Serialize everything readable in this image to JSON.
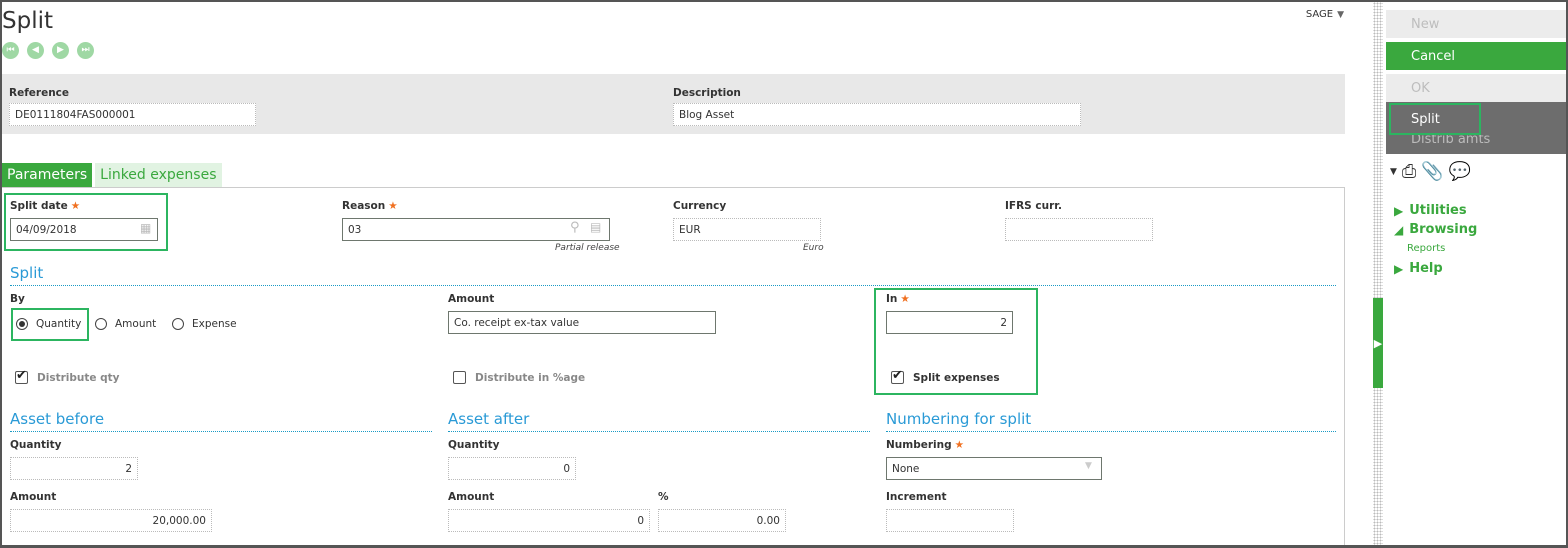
{
  "page": {
    "title": "Split",
    "user_menu": "SAGE",
    "nav": [
      "first",
      "previous",
      "next",
      "last"
    ]
  },
  "header": {
    "reference_label": "Reference",
    "reference_value": "DE0111804FAS000001",
    "description_label": "Description",
    "description_value": "Blog Asset"
  },
  "tabs": [
    {
      "label": "Parameters",
      "active": true
    },
    {
      "label": "Linked expenses",
      "active": false
    }
  ],
  "params": {
    "split_date_label": "Split date",
    "split_date_value": "04/09/2018",
    "reason_label": "Reason",
    "reason_value": "03",
    "reason_desc": "Partial release",
    "currency_label": "Currency",
    "currency_value": "EUR",
    "currency_desc": "Euro",
    "ifrs_label": "IFRS curr.",
    "ifrs_value": ""
  },
  "split": {
    "title": "Split",
    "by_label": "By",
    "by_options": [
      "Quantity",
      "Amount",
      "Expense"
    ],
    "by_selected": "Quantity",
    "amount_label": "Amount",
    "amount_value": "Co. receipt ex-tax value",
    "in_label": "In",
    "in_value": "2",
    "distribute_qty_label": "Distribute qty",
    "distribute_qty_checked": true,
    "distribute_pct_label": "Distribute in %age",
    "distribute_pct_checked": false,
    "split_expenses_label": "Split expenses",
    "split_expenses_checked": true
  },
  "asset_before": {
    "title": "Asset before",
    "quantity_label": "Quantity",
    "quantity_value": "2",
    "amount_label": "Amount",
    "amount_value": "20,000.00"
  },
  "asset_after": {
    "title": "Asset after",
    "quantity_label": "Quantity",
    "quantity_value": "0",
    "amount_label": "Amount",
    "amount_value": "0",
    "pct_label": "%",
    "pct_value": "0.00"
  },
  "numbering": {
    "title": "Numbering for split",
    "numbering_label": "Numbering",
    "numbering_value": "None",
    "increment_label": "Increment",
    "increment_value": ""
  },
  "actions": {
    "new": "New",
    "cancel": "Cancel",
    "ok": "OK",
    "split": "Split",
    "distrib": "Distrib amts"
  },
  "side_menu": {
    "utilities": "Utilities",
    "browsing": "Browsing",
    "reports": "Reports",
    "help": "Help"
  },
  "colors": {
    "accent_green": "#3aa83e",
    "section_blue": "#2a9ad6",
    "required_orange": "#f07020",
    "highlight_green": "#2cb560"
  }
}
